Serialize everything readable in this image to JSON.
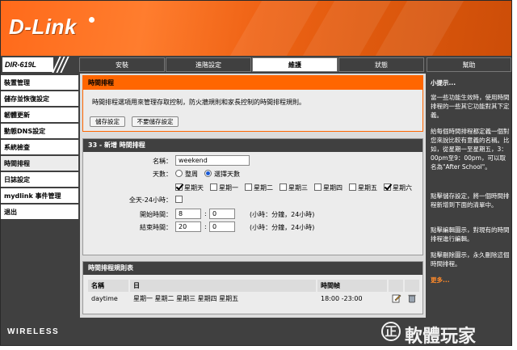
{
  "header": {
    "logo": "D-Link",
    "model": "DIR-619L"
  },
  "nav": {
    "tabs": [
      "安裝",
      "進階設定",
      "維護",
      "狀態",
      "幫助"
    ],
    "active": 2
  },
  "sidebar": {
    "items": [
      "裝置管理",
      "儲存並恢復設定",
      "韌體更新",
      "動態DNS設定",
      "系統檢查",
      "時間排程",
      "日誌設定",
      "mydlink 事件管理",
      "退出"
    ],
    "active": 5
  },
  "schedule_panel": {
    "title": "時間排程",
    "description": "時間排程選項用來管理存取控制，防火牆規則和家長控制的時間排程規則。",
    "save_label": "儲存設定",
    "nosave_label": "不要儲存設定"
  },
  "add_panel": {
    "title": "33 - 新增 時間排程",
    "name_label": "名稱：",
    "name_value": "weekend",
    "days_label": "天數：",
    "days_options": [
      "整周",
      "選擇天數"
    ],
    "days_selected": 1,
    "days": [
      {
        "label": "星期天",
        "checked": true
      },
      {
        "label": "星期一",
        "checked": false
      },
      {
        "label": "星期二",
        "checked": false
      },
      {
        "label": "星期三",
        "checked": false
      },
      {
        "label": "星期四",
        "checked": false
      },
      {
        "label": "星期五",
        "checked": false
      },
      {
        "label": "星期六",
        "checked": true
      }
    ],
    "allday_label": "全天-24小時：",
    "allday_checked": false,
    "start_label": "開始時間：",
    "start_hour": "8",
    "start_min": "0",
    "end_label": "結束時間：",
    "end_hour": "20",
    "end_min": "0",
    "time_hint": "(小時：分鐘，24小時)"
  },
  "rules_panel": {
    "title": "時間排程規則表",
    "headers": [
      "名稱",
      "日",
      "時間幀"
    ],
    "rows": [
      {
        "name": "daytime",
        "days": "星期一 星期二 星期三 星期四 星期五",
        "time": "18:00 -23:00"
      }
    ]
  },
  "hints": {
    "title": "小提示...",
    "paragraphs": [
      "當一些功能生效時，使用時間排程的一些其它功能對其下定義。",
      "給每個時間排程都定義一個對您來說比較有意義的名稱。比如，從星期一至星期五，3：00pm至9：00pm，可以取名為\"After School\"。",
      "點擊儲存設定，將一個時間排程新增到下面的清單中。",
      "點擊編輯圖示，對現有的時間排程進行編輯。",
      "點擊刪除圖示，永久刪除這個時間排程。"
    ],
    "more": "更多..."
  },
  "footer": {
    "brand": "WIRELESS",
    "watermark": "軟體玩家",
    "watermark_mark": "正"
  },
  "colors": {
    "accent": "#ff6600",
    "dark": "#404040"
  }
}
